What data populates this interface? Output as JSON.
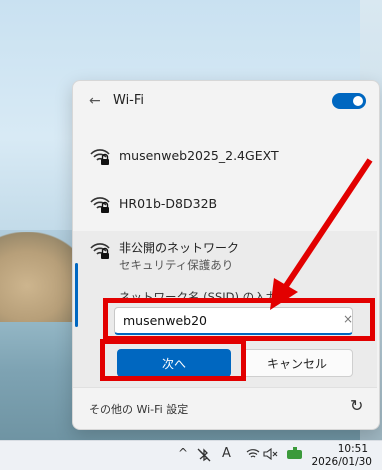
{
  "flyout": {
    "back_glyph": "←",
    "title": "Wi-Fi",
    "wifi_toggle_on": true
  },
  "networks": [
    {
      "ssid": "musenweb2025_2.4GEXT",
      "icon": "wifi-secured-icon"
    },
    {
      "ssid": "HR01b-D8D32B",
      "icon": "wifi-secured-icon"
    }
  ],
  "hidden_network": {
    "name": "非公開のネットワーク",
    "security": "セキュリティ保護あり",
    "ssid_label": "ネットワーク名 (SSID) の入力",
    "ssid_value": "musenweb20",
    "clear_glyph": "×",
    "next_label": "次へ",
    "cancel_label": "キャンセル"
  },
  "footer": {
    "more_settings": "その他の Wi-Fi 設定",
    "refresh_glyph": "↻"
  },
  "taskbar": {
    "chevron": "^",
    "input_mode": "A",
    "time": "10:51",
    "date": "2026/01/30"
  },
  "colors": {
    "accent": "#0067c0",
    "annotation": "#e20000"
  }
}
